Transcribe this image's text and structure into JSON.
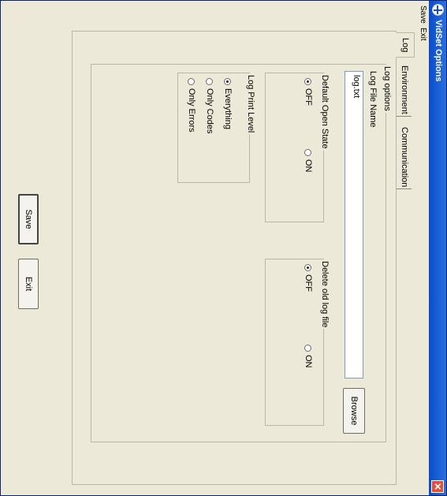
{
  "window": {
    "title": "VidSet Options",
    "close_glyph": "✕"
  },
  "menu": [
    "Save",
    "Exit"
  ],
  "tabs": [
    "Log",
    "Environment",
    "Communication"
  ],
  "log_options": {
    "group_label": "Log options",
    "file_name_label": "Log File Name",
    "file_name_value": "log.txt",
    "browse_label": "Browse",
    "default_open_state": {
      "label": "Default Open State",
      "options": [
        "OFF",
        "ON"
      ],
      "selected": "OFF"
    },
    "delete_old": {
      "label": "Delete old log file",
      "options": [
        "OFF",
        "ON"
      ],
      "selected": "OFF"
    },
    "print_level": {
      "label": "Log Print Level",
      "options": [
        "Everything",
        "Only Codes",
        "Only Errors"
      ],
      "selected": "Everything"
    }
  },
  "buttons": {
    "save": "Save",
    "exit": "Exit"
  }
}
